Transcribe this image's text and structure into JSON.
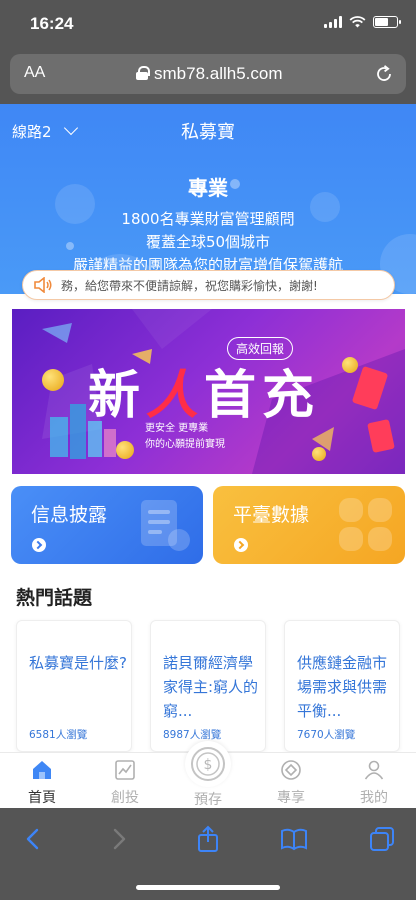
{
  "status_bar": {
    "time": "16:24"
  },
  "address_bar": {
    "aa_label": "AA",
    "url": "smb78.allh5.com"
  },
  "header": {
    "route_label": "線路2",
    "app_title": "私募寶",
    "headline": "專業",
    "lines": [
      "1800名專業財富管理顧問",
      "覆蓋全球50個城市",
      "嚴謹精益的團隊為您的財富增值保駕護航"
    ]
  },
  "notice": {
    "text": "務，給您帶來不便請諒解，祝您購彩愉快，謝謝!"
  },
  "banner": {
    "tag": "高效回報",
    "title_left": "新",
    "title_mid": "人",
    "title_right": "首充",
    "sub1": "更安全 更專業",
    "sub2": "你的心願提前實現"
  },
  "cards": [
    {
      "title": "信息披露",
      "color": "#3d7cee"
    },
    {
      "title": "平臺數據",
      "color": "#f5a623"
    }
  ],
  "hot_topics": {
    "title": "熱門話題",
    "items": [
      {
        "title": "私募寶是什麼?",
        "views": "6581人瀏覽"
      },
      {
        "title": "諾貝爾經濟學家得主:窮人的窮...",
        "views": "8987人瀏覽"
      },
      {
        "title": "供應鏈金融市場需求與供需平衡...",
        "views": "7670人瀏覽"
      }
    ]
  },
  "tab_bar": {
    "items": [
      {
        "label": "首頁",
        "icon": "home-icon",
        "active": true
      },
      {
        "label": "創投",
        "icon": "chart-icon"
      },
      {
        "label": "預存",
        "icon": "dollar-coin-icon"
      },
      {
        "label": "專享",
        "icon": "diamond-icon"
      },
      {
        "label": "我的",
        "icon": "user-icon"
      }
    ]
  },
  "colors": {
    "primary": "#3f87f5",
    "accent_orange": "#f5a623",
    "banner_red": "#ff2d48",
    "browser_chrome": "#555555"
  }
}
